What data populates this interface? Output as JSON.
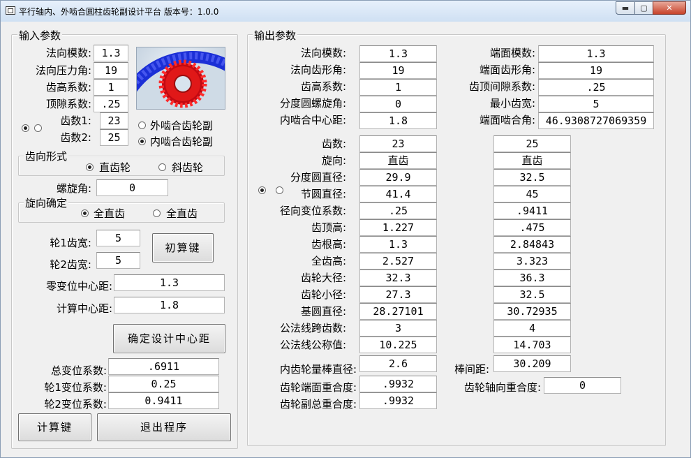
{
  "window": {
    "title": "平行轴内、外啮合圆柱齿轮副设计平台 版本号：1.0.0",
    "min_label": "▬",
    "max_label": "▢",
    "close_label": "✕"
  },
  "input": {
    "legend": "输入参数",
    "normal_module": {
      "label": "法向模数:",
      "value": "1.3"
    },
    "pressure_angle": {
      "label": "法向压力角:",
      "value": "19"
    },
    "addendum_coef": {
      "label": "齿高系数:",
      "value": "1"
    },
    "clearance_coef": {
      "label": "顶隙系数:",
      "value": ".25"
    },
    "teeth1": {
      "label": "齿数1:",
      "value": "23"
    },
    "teeth2": {
      "label": "齿数2:",
      "value": "25"
    },
    "mesh_external": "外啮合齿轮副",
    "mesh_internal": "内啮合齿轮副",
    "tooth_direction": {
      "legend": "齿向形式",
      "spur": "直齿轮",
      "helical": "斜齿轮"
    },
    "helix_angle": {
      "label": "螺旋角:",
      "value": "0"
    },
    "hand": {
      "legend": "旋向确定",
      "opt1": "全直齿",
      "opt2": "全直齿"
    },
    "width1": {
      "label": "轮1齿宽:",
      "value": "5"
    },
    "width2": {
      "label": "轮2齿宽:",
      "value": "5"
    },
    "initial_calc_button": "初算键",
    "zero_shift_center": {
      "label": "零变位中心距:",
      "value": "1.3"
    },
    "calc_center": {
      "label": "计算中心距:",
      "value": "1.8"
    },
    "confirm_center_button": "确定设计中心距",
    "total_shift": {
      "label": "总变位系数:",
      "value": ".6911"
    },
    "shift1": {
      "label": "轮1变位系数:",
      "value": "0.25"
    },
    "shift2": {
      "label": "轮2变位系数:",
      "value": "0.9411"
    },
    "calc_button": "计算键",
    "exit_button": "退出程序"
  },
  "output": {
    "legend": "输出参数",
    "normal_module": {
      "label": "法向模数:",
      "value": "1.3"
    },
    "normal_profile_angle": {
      "label": "法向齿形角:",
      "value": "19"
    },
    "addendum_coef": {
      "label": "齿高系数:",
      "value": "1"
    },
    "ref_helix_angle": {
      "label": "分度圆螺旋角:",
      "value": "0"
    },
    "internal_center": {
      "label": "内啮合中心距:",
      "value": "1.8"
    },
    "transverse_module": {
      "label": "端面模数:",
      "value": "1.3"
    },
    "transverse_profile_angle": {
      "label": "端面齿形角:",
      "value": "19"
    },
    "tip_clearance_coef": {
      "label": "齿顶间隙系数:",
      "value": ".25"
    },
    "min_teeth": {
      "label": "最小齿宽:",
      "value": "5"
    },
    "transverse_mesh_angle": {
      "label": "端面啮合角:",
      "value": "46.9308727069359"
    },
    "table": [
      {
        "label": "齿数:",
        "g1": "23",
        "g2": "25"
      },
      {
        "label": "旋向:",
        "g1": "直齿",
        "g2": "直齿"
      },
      {
        "label": "分度圆直径:",
        "g1": "29.9",
        "g2": "32.5"
      },
      {
        "label": "节圆直径:",
        "g1": "41.4",
        "g2": "45"
      },
      {
        "label": "径向变位系数:",
        "g1": ".25",
        "g2": ".9411"
      },
      {
        "label": "齿顶高:",
        "g1": "1.227",
        "g2": ".475"
      },
      {
        "label": "齿根高:",
        "g1": "1.3",
        "g2": "2.84843"
      },
      {
        "label": "全齿高:",
        "g1": "2.527",
        "g2": "3.323"
      },
      {
        "label": "齿轮大径:",
        "g1": "32.3",
        "g2": "36.3"
      },
      {
        "label": "齿轮小径:",
        "g1": "27.3",
        "g2": "32.5"
      },
      {
        "label": "基圆直径:",
        "g1": "28.27101",
        "g2": "30.72935"
      },
      {
        "label": "公法线跨齿数:",
        "g1": "3",
        "g2": "4"
      },
      {
        "label": "公法线公称值:",
        "g1": "10.225",
        "g2": "14.703"
      }
    ],
    "rod_diameter": {
      "label": "内齿轮量棒直径:",
      "value": "2.6"
    },
    "rod_distance": {
      "label": "棒间距:",
      "value": "30.209"
    },
    "transverse_contact_ratio": {
      "label": "齿轮端面重合度:",
      "value": ".9932"
    },
    "axial_contact_ratio": {
      "label": "齿轮轴向重合度:",
      "value": "0"
    },
    "total_contact_ratio": {
      "label": "齿轮副总重合度:",
      "value": ".9932"
    }
  }
}
